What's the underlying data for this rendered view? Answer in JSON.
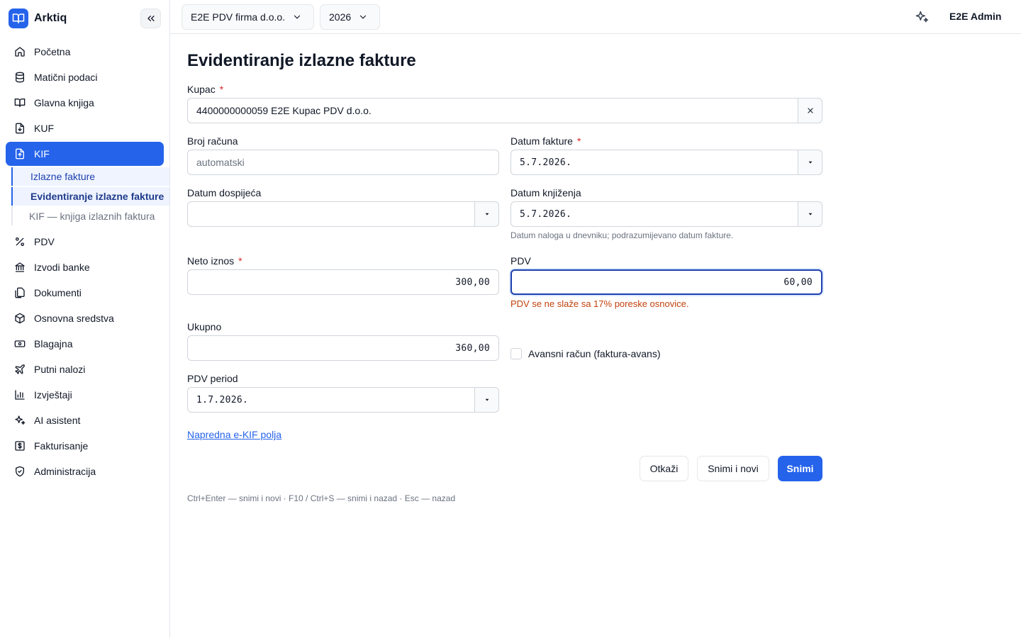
{
  "app": {
    "name": "Arktiq"
  },
  "sidebar": {
    "items": [
      {
        "label": "Početna",
        "icon": "home-icon"
      },
      {
        "label": "Matični podaci",
        "icon": "database-icon"
      },
      {
        "label": "Glavna knjiga",
        "icon": "book-icon"
      },
      {
        "label": "KUF",
        "icon": "file-download-icon"
      },
      {
        "label": "KIF",
        "icon": "file-upload-icon"
      },
      {
        "label": "PDV",
        "icon": "percent-icon"
      },
      {
        "label": "Izvodi banke",
        "icon": "bank-icon"
      },
      {
        "label": "Dokumenti",
        "icon": "documents-icon"
      },
      {
        "label": "Osnovna sredstva",
        "icon": "box-icon"
      },
      {
        "label": "Blagajna",
        "icon": "cash-icon"
      },
      {
        "label": "Putni nalozi",
        "icon": "plane-icon"
      },
      {
        "label": "Izvještaji",
        "icon": "bar-chart-icon"
      },
      {
        "label": "AI asistent",
        "icon": "sparkles-icon"
      },
      {
        "label": "Fakturisanje",
        "icon": "invoice-dollar-icon"
      },
      {
        "label": "Administracija",
        "icon": "shield-icon"
      }
    ],
    "kif_sub": [
      "Izlazne fakture",
      "Evidentiranje izlazne fakture",
      "KIF — knjiga izlaznih faktura"
    ]
  },
  "topbar": {
    "company": "E2E PDV firma d.o.o.",
    "year": "2026",
    "user": "E2E Admin"
  },
  "form": {
    "title": "Evidentiranje izlazne fakture",
    "kupac_label": "Kupac",
    "kupac_value": "4400000000059 E2E Kupac PDV d.o.o.",
    "broj_label": "Broj računa",
    "broj_placeholder": "automatski",
    "datum_fakture_label": "Datum fakture",
    "datum_fakture_value": "5.7.2026.",
    "datum_dospijeca_label": "Datum dospijeća",
    "datum_dospijeca_value": "",
    "datum_knjizenja_label": "Datum knjiženja",
    "datum_knjizenja_value": "5.7.2026.",
    "datum_knjizenja_hint": "Datum naloga u dnevniku; podrazumijevano datum fakture.",
    "neto_label": "Neto iznos",
    "neto_value": "300,00",
    "pdv_label": "PDV",
    "pdv_value": "60,00",
    "pdv_error": "PDV se ne slaže sa 17% poreske osnovice.",
    "ukupno_label": "Ukupno",
    "ukupno_value": "360,00",
    "avans_label": "Avansni račun (faktura-avans)",
    "pdv_period_label": "PDV period",
    "pdv_period_value": "1.7.2026.",
    "advanced_link": "Napredna e-KIF polja",
    "cancel": "Otkaži",
    "save_new": "Snimi i novi",
    "save": "Snimi",
    "shortcuts": "Ctrl+Enter — snimi i novi · F10 / Ctrl+S — snimi i nazad · Esc — nazad"
  },
  "colors": {
    "accent": "#2563eb",
    "error": "#c2410c",
    "required": "#dc2626"
  }
}
